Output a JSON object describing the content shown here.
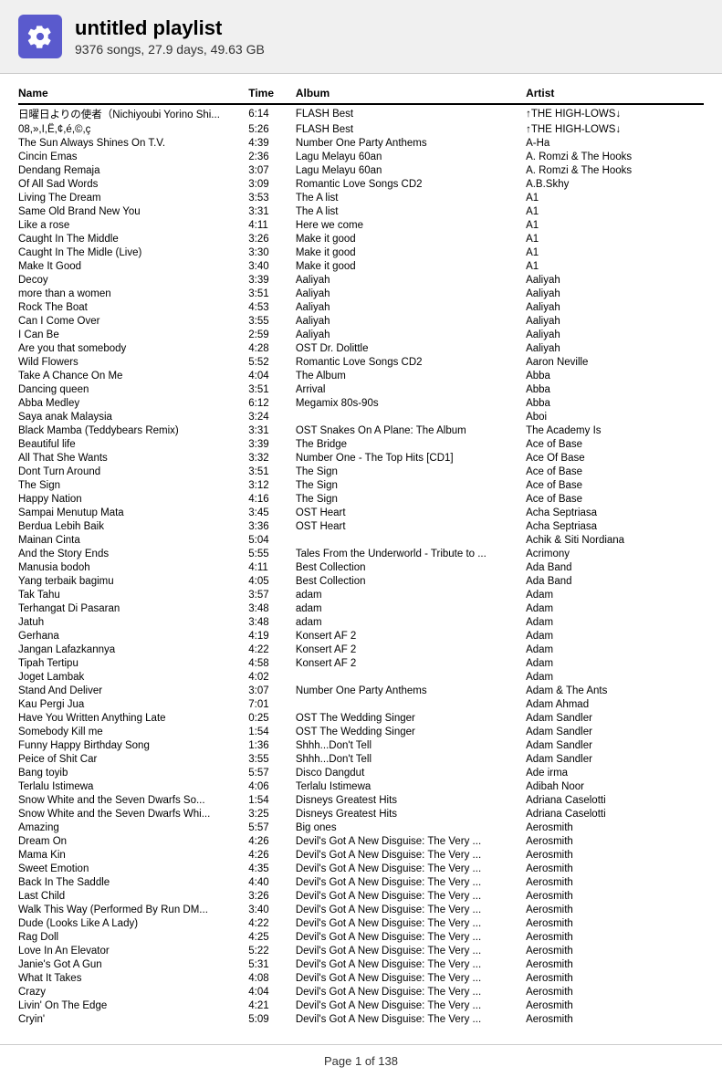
{
  "header": {
    "title": "untitled playlist",
    "subtitle": "9376 songs, 27.9 days, 49.63 GB",
    "icon_label": "gear-icon"
  },
  "columns": {
    "name": "Name",
    "time": "Time",
    "album": "Album",
    "artist": "Artist"
  },
  "songs": [
    {
      "name": "日曜日よりの使者（Nichiyoubi Yorino Shi...",
      "time": "6:14",
      "album": "FLASH Best",
      "artist": "↑THE HIGH-LOWS↓"
    },
    {
      "name": "08,»,I,Ë,¢,é,©,ç",
      "time": "5:26",
      "album": "FLASH Best",
      "artist": "↑THE HIGH-LOWS↓"
    },
    {
      "name": "The Sun Always Shines On T.V.",
      "time": "4:39",
      "album": "Number One Party Anthems",
      "artist": "A-Ha"
    },
    {
      "name": "Cincin Emas",
      "time": "2:36",
      "album": "Lagu Melayu 60an",
      "artist": "A. Romzi & The Hooks"
    },
    {
      "name": "Dendang Remaja",
      "time": "3:07",
      "album": "Lagu Melayu 60an",
      "artist": "A. Romzi & The Hooks"
    },
    {
      "name": "Of All Sad Words",
      "time": "3:09",
      "album": "Romantic Love Songs CD2",
      "artist": "A.B.Skhy"
    },
    {
      "name": "Living The Dream",
      "time": "3:53",
      "album": "The A list",
      "artist": "A1"
    },
    {
      "name": "Same Old Brand New You",
      "time": "3:31",
      "album": "The A list",
      "artist": "A1"
    },
    {
      "name": "Like a rose",
      "time": "4:11",
      "album": "Here we come",
      "artist": "A1"
    },
    {
      "name": "Caught In The Middle",
      "time": "3:26",
      "album": "Make it good",
      "artist": "A1"
    },
    {
      "name": "Caught In The Midle (Live)",
      "time": "3:30",
      "album": "Make it good",
      "artist": "A1"
    },
    {
      "name": "Make It Good",
      "time": "3:40",
      "album": "Make it good",
      "artist": "A1"
    },
    {
      "name": "Decoy",
      "time": "3:39",
      "album": "Aaliyah",
      "artist": "Aaliyah"
    },
    {
      "name": "more than a women",
      "time": "3:51",
      "album": "Aaliyah",
      "artist": "Aaliyah"
    },
    {
      "name": "Rock The Boat",
      "time": "4:53",
      "album": "Aaliyah",
      "artist": "Aaliyah"
    },
    {
      "name": "Can I Come Over",
      "time": "3:55",
      "album": "Aaliyah",
      "artist": "Aaliyah"
    },
    {
      "name": "I Can Be",
      "time": "2:59",
      "album": "Aaliyah",
      "artist": "Aaliyah"
    },
    {
      "name": "Are you that somebody",
      "time": "4:28",
      "album": "OST Dr. Dolittle",
      "artist": "Aaliyah"
    },
    {
      "name": "Wild Flowers",
      "time": "5:52",
      "album": "Romantic Love Songs CD2",
      "artist": "Aaron Neville"
    },
    {
      "name": "Take A Chance On Me",
      "time": "4:04",
      "album": "The Album",
      "artist": "Abba"
    },
    {
      "name": "Dancing queen",
      "time": "3:51",
      "album": "Arrival",
      "artist": "Abba"
    },
    {
      "name": "Abba Medley",
      "time": "6:12",
      "album": "Megamix 80s-90s",
      "artist": "Abba"
    },
    {
      "name": "Saya anak Malaysia",
      "time": "3:24",
      "album": "",
      "artist": "Aboi"
    },
    {
      "name": "Black Mamba (Teddybears Remix)",
      "time": "3:31",
      "album": "OST Snakes On A Plane: The Album",
      "artist": "The Academy Is"
    },
    {
      "name": "Beautiful life",
      "time": "3:39",
      "album": "The Bridge",
      "artist": "Ace of Base"
    },
    {
      "name": "All That She Wants",
      "time": "3:32",
      "album": "Number One - The Top Hits [CD1]",
      "artist": "Ace Of Base"
    },
    {
      "name": "Dont Turn Around",
      "time": "3:51",
      "album": "The Sign",
      "artist": "Ace of Base"
    },
    {
      "name": "The Sign",
      "time": "3:12",
      "album": "The Sign",
      "artist": "Ace of Base"
    },
    {
      "name": "Happy Nation",
      "time": "4:16",
      "album": "The Sign",
      "artist": "Ace of Base"
    },
    {
      "name": "Sampai Menutup Mata",
      "time": "3:45",
      "album": "OST Heart",
      "artist": "Acha Septriasa"
    },
    {
      "name": "Berdua Lebih Baik",
      "time": "3:36",
      "album": "OST Heart",
      "artist": "Acha Septriasa"
    },
    {
      "name": "Mainan Cinta",
      "time": "5:04",
      "album": "",
      "artist": "Achik & Siti Nordiana"
    },
    {
      "name": "And the Story Ends",
      "time": "5:55",
      "album": "Tales From the Underworld - Tribute to ...",
      "artist": "Acrimony"
    },
    {
      "name": "Manusia bodoh",
      "time": "4:11",
      "album": "Best Collection",
      "artist": "Ada Band"
    },
    {
      "name": "Yang terbaik bagimu",
      "time": "4:05",
      "album": "Best Collection",
      "artist": "Ada Band"
    },
    {
      "name": "Tak Tahu",
      "time": "3:57",
      "album": "adam",
      "artist": "Adam"
    },
    {
      "name": "Terhangat Di Pasaran",
      "time": "3:48",
      "album": "adam",
      "artist": "Adam"
    },
    {
      "name": "Jatuh",
      "time": "3:48",
      "album": "adam",
      "artist": "Adam"
    },
    {
      "name": "Gerhana",
      "time": "4:19",
      "album": "Konsert AF 2",
      "artist": "Adam"
    },
    {
      "name": "Jangan Lafazkannya",
      "time": "4:22",
      "album": "Konsert AF 2",
      "artist": "Adam"
    },
    {
      "name": "Tipah Tertipu",
      "time": "4:58",
      "album": "Konsert AF 2",
      "artist": "Adam"
    },
    {
      "name": "Joget Lambak",
      "time": "4:02",
      "album": "",
      "artist": "Adam"
    },
    {
      "name": "Stand And Deliver",
      "time": "3:07",
      "album": "Number One Party Anthems",
      "artist": "Adam & The Ants"
    },
    {
      "name": "Kau Pergi Jua",
      "time": "7:01",
      "album": "",
      "artist": "Adam Ahmad"
    },
    {
      "name": "Have You Written Anything Late",
      "time": "0:25",
      "album": "OST The Wedding Singer",
      "artist": "Adam Sandler"
    },
    {
      "name": "Somebody Kill me",
      "time": "1:54",
      "album": "OST The Wedding Singer",
      "artist": "Adam Sandler"
    },
    {
      "name": "Funny Happy Birthday Song",
      "time": "1:36",
      "album": "Shhh...Don't Tell",
      "artist": "Adam Sandler"
    },
    {
      "name": "Peice of Shit Car",
      "time": "3:55",
      "album": "Shhh...Don't Tell",
      "artist": "Adam Sandler"
    },
    {
      "name": "Bang toyib",
      "time": "5:57",
      "album": "Disco Dangdut",
      "artist": "Ade irma"
    },
    {
      "name": "Terlalu Istimewa",
      "time": "4:06",
      "album": "Terlalu Istimewa",
      "artist": "Adibah Noor"
    },
    {
      "name": "Snow White and the Seven Dwarfs So...",
      "time": "1:54",
      "album": "Disneys Greatest Hits",
      "artist": "Adriana Caselotti"
    },
    {
      "name": "Snow White and the Seven Dwarfs Whi...",
      "time": "3:25",
      "album": "Disneys Greatest Hits",
      "artist": "Adriana Caselotti"
    },
    {
      "name": "Amazing",
      "time": "5:57",
      "album": "Big ones",
      "artist": "Aerosmith"
    },
    {
      "name": "Dream On",
      "time": "4:26",
      "album": "Devil's Got A New Disguise: The Very ...",
      "artist": "Aerosmith"
    },
    {
      "name": "Mama Kin",
      "time": "4:26",
      "album": "Devil's Got A New Disguise: The Very ...",
      "artist": "Aerosmith"
    },
    {
      "name": "Sweet Emotion",
      "time": "4:35",
      "album": "Devil's Got A New Disguise: The Very ...",
      "artist": "Aerosmith"
    },
    {
      "name": "Back In The Saddle",
      "time": "4:40",
      "album": "Devil's Got A New Disguise: The Very ...",
      "artist": "Aerosmith"
    },
    {
      "name": "Last Child",
      "time": "3:26",
      "album": "Devil's Got A New Disguise: The Very ...",
      "artist": "Aerosmith"
    },
    {
      "name": "Walk This Way (Performed By Run DM...",
      "time": "3:40",
      "album": "Devil's Got A New Disguise: The Very ...",
      "artist": "Aerosmith"
    },
    {
      "name": "Dude (Looks Like A Lady)",
      "time": "4:22",
      "album": "Devil's Got A New Disguise: The Very ...",
      "artist": "Aerosmith"
    },
    {
      "name": "Rag Doll",
      "time": "4:25",
      "album": "Devil's Got A New Disguise: The Very ...",
      "artist": "Aerosmith"
    },
    {
      "name": "Love In An Elevator",
      "time": "5:22",
      "album": "Devil's Got A New Disguise: The Very ...",
      "artist": "Aerosmith"
    },
    {
      "name": "Janie's Got A Gun",
      "time": "5:31",
      "album": "Devil's Got A New Disguise: The Very ...",
      "artist": "Aerosmith"
    },
    {
      "name": "What It Takes",
      "time": "4:08",
      "album": "Devil's Got A New Disguise: The Very ...",
      "artist": "Aerosmith"
    },
    {
      "name": "Crazy",
      "time": "4:04",
      "album": "Devil's Got A New Disguise: The Very ...",
      "artist": "Aerosmith"
    },
    {
      "name": "Livin' On The Edge",
      "time": "4:21",
      "album": "Devil's Got A New Disguise: The Very ...",
      "artist": "Aerosmith"
    },
    {
      "name": "Cryin'",
      "time": "5:09",
      "album": "Devil's Got A New Disguise: The Very ...",
      "artist": "Aerosmith"
    }
  ],
  "footer": {
    "label": "Page 1 of 138"
  }
}
